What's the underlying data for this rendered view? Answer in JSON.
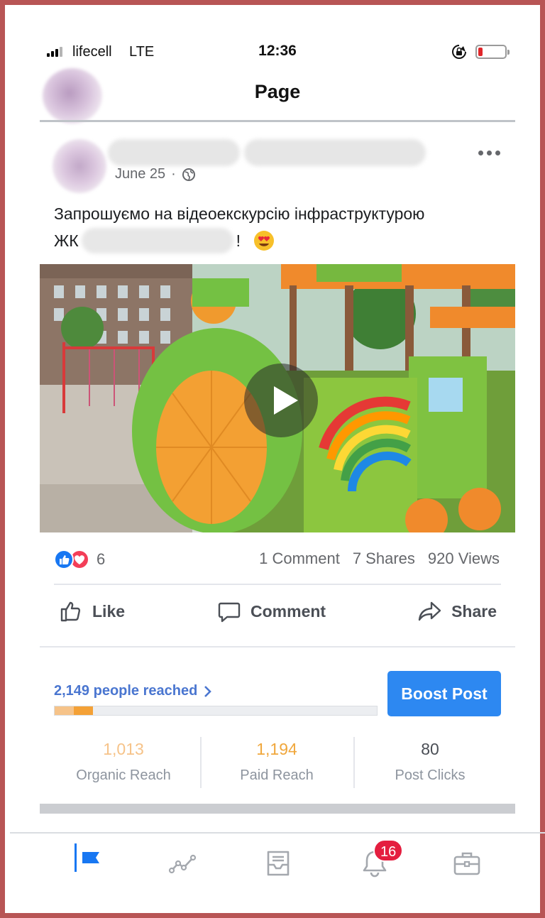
{
  "status_bar": {
    "carrier": "lifecell",
    "network": "LTE",
    "time": "12:36",
    "icons": [
      "signal-icon",
      "orientation-lock-icon",
      "battery-low-icon"
    ]
  },
  "header": {
    "title": "Page"
  },
  "post": {
    "date": "June 25",
    "separator": "·",
    "text_line1": "Запрошуємо на відеоекскурсію інфраструктурою",
    "text_line2_prefix": "ЖК",
    "text_line2_suffix": "!",
    "media_type": "video",
    "reactions": {
      "icons": [
        "like-reaction-icon",
        "love-reaction-icon"
      ],
      "count": "6"
    },
    "stats": {
      "comments": "1 Comment",
      "shares": "7 Shares",
      "views": "920 Views"
    },
    "actions": {
      "like": "Like",
      "comment": "Comment",
      "share": "Share"
    }
  },
  "insights": {
    "reached": "2,149 people reached",
    "reach_split": {
      "organic_fraction": 0.06,
      "paid_fraction": 0.06
    },
    "boost_label": "Boost Post",
    "metrics": [
      {
        "value": "1,013",
        "label": "Organic Reach",
        "color": "#f6c389"
      },
      {
        "value": "1,194",
        "label": "Paid Reach",
        "color": "#f0a73c"
      },
      {
        "value": "80",
        "label": "Post Clicks",
        "color": "#4b4f56"
      }
    ]
  },
  "tabbar": {
    "tabs": [
      "page-flag-icon",
      "insights-graph-icon",
      "inbox-icon",
      "notifications-bell-icon",
      "tools-briefcase-icon"
    ],
    "notifications_badge": "16",
    "active_color": "#1877f2",
    "inactive_color": "#a4a8ae"
  },
  "colors": {
    "brand_blue": "#1877f2",
    "boost_blue": "#2d88f1",
    "reached_link": "#4a76d0",
    "frame_border": "#b85555"
  }
}
